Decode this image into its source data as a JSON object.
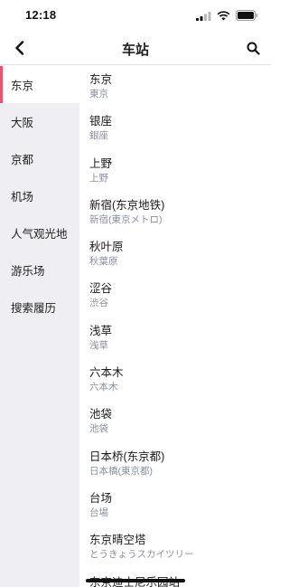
{
  "status_bar": {
    "time": "12:18"
  },
  "nav": {
    "title": "车站"
  },
  "sidebar": {
    "items": [
      {
        "label": "东京"
      },
      {
        "label": "大阪"
      },
      {
        "label": "京都"
      },
      {
        "label": "机场"
      },
      {
        "label": "人气观光地"
      },
      {
        "label": "游乐场"
      },
      {
        "label": "搜索履历"
      }
    ],
    "active_index": 0
  },
  "stations": [
    {
      "name": "东京",
      "sub": "東京"
    },
    {
      "name": "银座",
      "sub": "銀座"
    },
    {
      "name": "上野",
      "sub": "上野"
    },
    {
      "name": "新宿(东京地铁)",
      "sub": "新宿(東京メトロ)"
    },
    {
      "name": "秋叶原",
      "sub": "秋葉原"
    },
    {
      "name": "涩谷",
      "sub": "渋谷"
    },
    {
      "name": "浅草",
      "sub": "浅草"
    },
    {
      "name": "六本木",
      "sub": "六本木"
    },
    {
      "name": "池袋",
      "sub": "池袋"
    },
    {
      "name": "日本桥(东京都)",
      "sub": "日本橋(東京都)"
    },
    {
      "name": "台场",
      "sub": "台場"
    },
    {
      "name": "东京晴空塔",
      "sub": "とうきょうスカイツリー"
    },
    {
      "name": "东京迪士尼乐园站",
      "sub": ""
    }
  ],
  "colors": {
    "accent": "#f0506e",
    "sidebar_bg": "#efeff3",
    "sub_text": "#8a8fa0"
  },
  "icons": {
    "back": "chevron-left-icon",
    "search": "search-icon",
    "signal": "signal-icon",
    "wifi": "wifi-icon",
    "battery": "battery-icon"
  }
}
